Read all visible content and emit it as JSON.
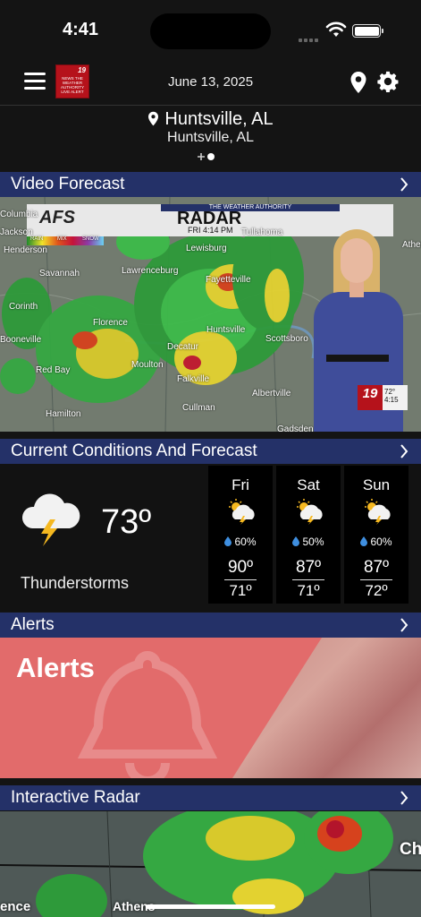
{
  "status_bar": {
    "time": "4:41"
  },
  "header": {
    "date": "June 13, 2025",
    "logo_number": "19",
    "logo_text": "NEWS THE WEATHER AUTHORITY LIVE ALERT"
  },
  "location": {
    "primary": "Huntsville, AL",
    "secondary": "Huntsville, AL"
  },
  "video_forecast": {
    "title": "Video Forecast",
    "banner_top": "THE WEATHER AUTHORITY",
    "banner_brand": "AFS",
    "banner_title": "RADAR",
    "banner_time": "FRI 4:14 PM",
    "legend": [
      "RAIN",
      "MIX",
      "SNOW"
    ],
    "map_labels": [
      "Columbia",
      "Jackson",
      "Henderson",
      "Savannah",
      "Lawrenceburg",
      "Lewisburg",
      "Tullahoma",
      "Fayetteville",
      "Athens",
      "Corinth",
      "Florence",
      "Huntsville",
      "Scottsboro",
      "Decatur",
      "Moulton",
      "Red Bay",
      "Falkville",
      "Albertville",
      "Hamilton",
      "Cullman",
      "Gadsden",
      "Booneville"
    ],
    "station_number": "19",
    "station_temp": "72°",
    "station_time": "4:15"
  },
  "current": {
    "title": "Current Conditions And Forecast",
    "temp": "73º",
    "condition": "Thunderstorms",
    "icon": "thunderstorm-icon",
    "forecast": [
      {
        "day": "Fri",
        "precip": "60%",
        "high": "90º",
        "low": "71º"
      },
      {
        "day": "Sat",
        "precip": "50%",
        "high": "87º",
        "low": "71º"
      },
      {
        "day": "Sun",
        "precip": "60%",
        "high": "87º",
        "low": "72º"
      }
    ]
  },
  "alerts": {
    "bar_title": "Alerts",
    "card_title": "Alerts"
  },
  "interactive_radar": {
    "title": "Interactive Radar",
    "labels": [
      "ence",
      "Athens",
      "Ch"
    ]
  },
  "colors": {
    "section_bar": "#243168",
    "alerts_bg": "#e26b6b",
    "background": "#141414"
  }
}
